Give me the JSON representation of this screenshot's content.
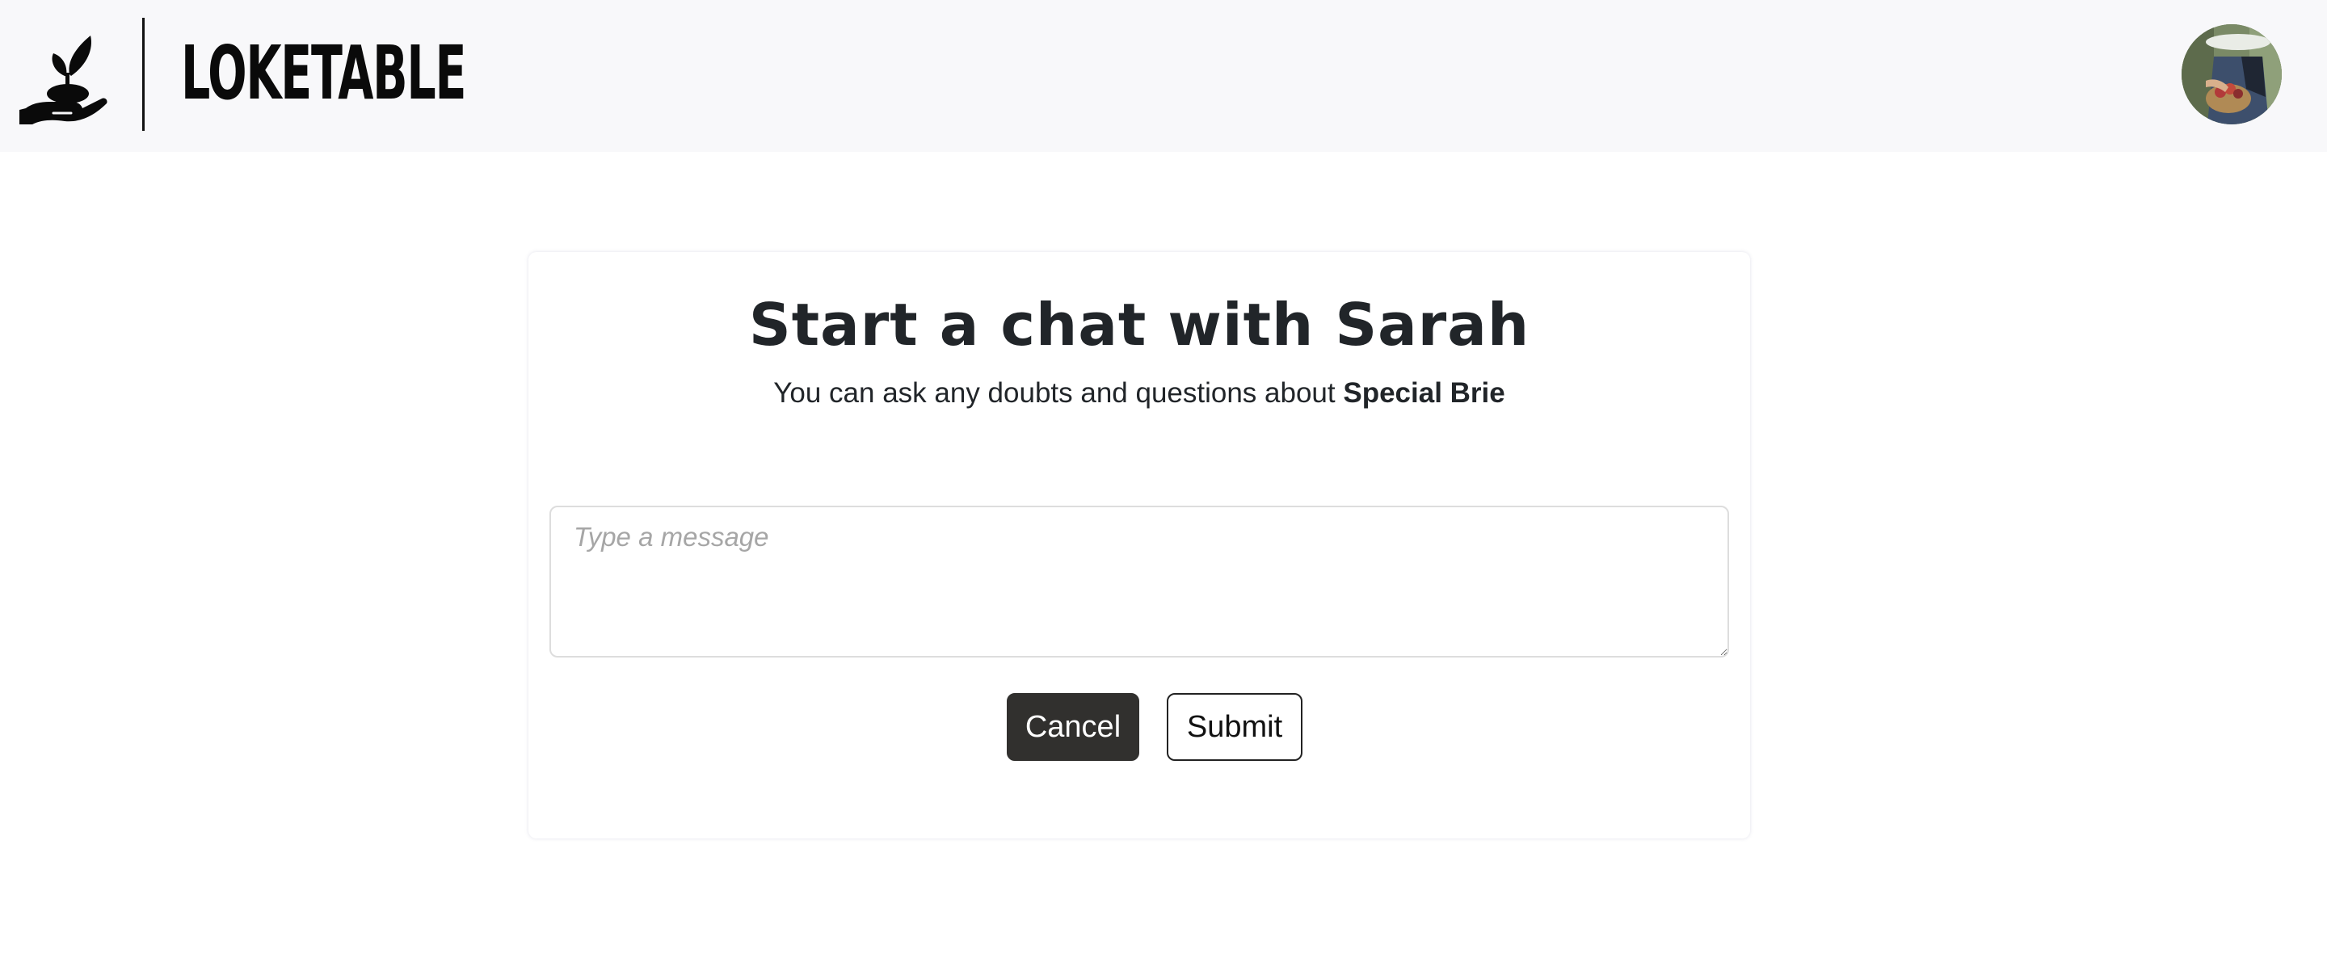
{
  "header": {
    "brand_name": "LOKETABLE",
    "logo_icon": "hand-with-sprout-icon",
    "avatar_icon": "user-avatar-photo"
  },
  "chat_card": {
    "title": "Start a chat with Sarah",
    "subtitle_prefix": "You can ask any doubts and questions about ",
    "product_name": "Special Brie",
    "message_placeholder": "Type a message",
    "message_value": "",
    "cancel_label": "Cancel",
    "submit_label": "Submit"
  },
  "colors": {
    "header_bg": "#f8f8fa",
    "text": "#212529",
    "cancel_bg": "#31302e",
    "placeholder": "#a6a6a6"
  }
}
